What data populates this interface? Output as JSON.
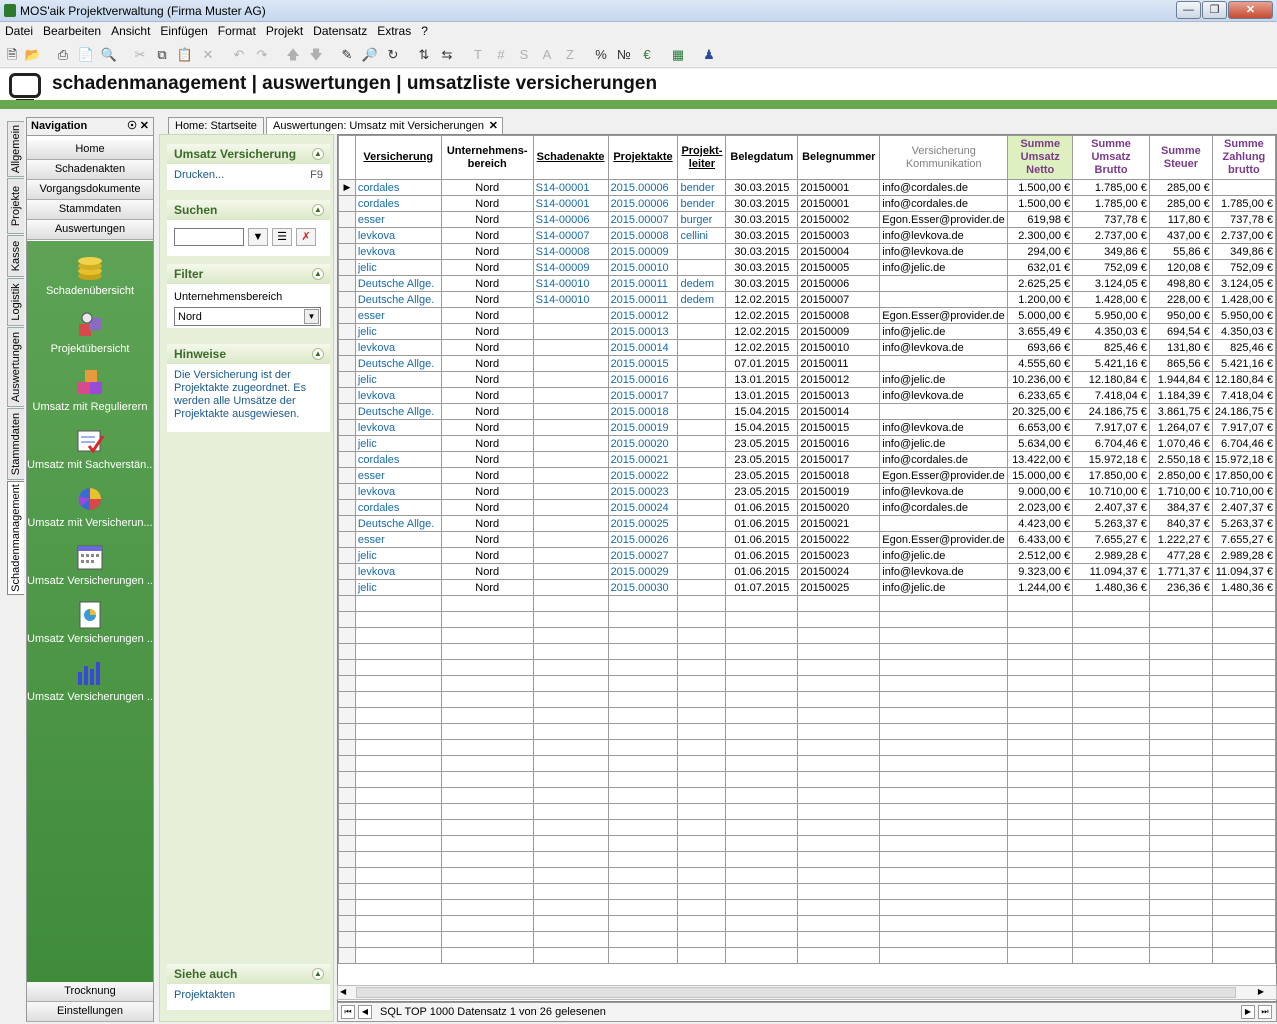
{
  "window": {
    "title": "MOS'aik Projektverwaltung (Firma Muster AG)"
  },
  "menu": [
    "Datei",
    "Bearbeiten",
    "Ansicht",
    "Einfügen",
    "Format",
    "Projekt",
    "Datensatz",
    "Extras",
    "?"
  ],
  "header": {
    "title": "schadenmanagement | auswertungen | umsatzliste versicherungen"
  },
  "vtabs": [
    "Allgemein",
    "Projekte",
    "Kasse",
    "Logistik",
    "Auswertungen",
    "Stammdaten",
    "Schadenmanagement"
  ],
  "nav": {
    "title": "Navigation",
    "pin": "☉",
    "close": "✕",
    "buttons": [
      "Home",
      "Schadenakten",
      "Vorgangsdokumente",
      "Stammdaten",
      "Auswertungen"
    ],
    "items": [
      "Schadenübersicht",
      "Projektübersicht",
      "Umsatz mit Regulierern",
      "Umsatz mit Sachverstän...",
      "Umsatz mit Versicherun...",
      "Umsatz Versicherungen ...",
      "Umsatz Versicherungen ...",
      "Umsatz Versicherungen ..."
    ],
    "bottom": [
      "Trocknung",
      "Einstellungen"
    ]
  },
  "tasks": {
    "g1": {
      "title": "Umsatz Versicherung",
      "item": "Drucken...",
      "key": "F9"
    },
    "g2": {
      "title": "Suchen",
      "search_value": ""
    },
    "g3": {
      "title": "Filter",
      "label": "Unternehmensbereich",
      "value": "Nord"
    },
    "g4": {
      "title": "Hinweise",
      "text": "Die Versicherung ist der Projektakte zugeordnet. Es werden alle Umsätze der Projektakte ausgewiesen."
    },
    "g5": {
      "title": "Siehe auch",
      "item": "Projektakten"
    }
  },
  "doctabs": {
    "home": "Home: Startseite",
    "active": "Auswertungen: Umsatz mit Versicherungen"
  },
  "columns": [
    "Versicherung",
    "Unternehmens-bereich",
    "Schadenakte",
    "Projektakte",
    "Projekt-leiter",
    "Belegdatum",
    "Belegnummer",
    "Versicherung Kommunikation",
    "Summe Umsatz Netto",
    "Summe Umsatz Brutto",
    "Summe Steuer",
    "Summe Zahlung brutto"
  ],
  "rows": [
    [
      "cordales",
      "Nord",
      "S14-00001",
      "2015.00006",
      "bender",
      "30.03.2015",
      "20150001",
      "info@cordales.de",
      "1.500,00 €",
      "1.785,00 €",
      "285,00 €",
      ""
    ],
    [
      "cordales",
      "Nord",
      "S14-00001",
      "2015.00006",
      "bender",
      "30.03.2015",
      "20150001",
      "info@cordales.de",
      "1.500,00 €",
      "1.785,00 €",
      "285,00 €",
      "1.785,00 €"
    ],
    [
      "esser",
      "Nord",
      "S14-00006",
      "2015.00007",
      "burger",
      "30.03.2015",
      "20150002",
      "Egon.Esser@provider.de",
      "619,98 €",
      "737,78 €",
      "117,80 €",
      "737,78 €"
    ],
    [
      "levkova",
      "Nord",
      "S14-00007",
      "2015.00008",
      "cellini",
      "30.03.2015",
      "20150003",
      "info@levkova.de",
      "2.300,00 €",
      "2.737,00 €",
      "437,00 €",
      "2.737,00 €"
    ],
    [
      "levkova",
      "Nord",
      "S14-00008",
      "2015.00009",
      "",
      "30.03.2015",
      "20150004",
      "info@levkova.de",
      "294,00 €",
      "349,86 €",
      "55,86 €",
      "349,86 €"
    ],
    [
      "jelic",
      "Nord",
      "S14-00009",
      "2015.00010",
      "",
      "30.03.2015",
      "20150005",
      "info@jelic.de",
      "632,01 €",
      "752,09 €",
      "120,08 €",
      "752,09 €"
    ],
    [
      "Deutsche Allge.",
      "Nord",
      "S14-00010",
      "2015.00011",
      "dedem",
      "30.03.2015",
      "20150006",
      "",
      "2.625,25 €",
      "3.124,05 €",
      "498,80 €",
      "3.124,05 €"
    ],
    [
      "Deutsche Allge.",
      "Nord",
      "S14-00010",
      "2015.00011",
      "dedem",
      "12.02.2015",
      "20150007",
      "",
      "1.200,00 €",
      "1.428,00 €",
      "228,00 €",
      "1.428,00 €"
    ],
    [
      "esser",
      "Nord",
      "",
      "2015.00012",
      "",
      "12.02.2015",
      "20150008",
      "Egon.Esser@provider.de",
      "5.000,00 €",
      "5.950,00 €",
      "950,00 €",
      "5.950,00 €"
    ],
    [
      "jelic",
      "Nord",
      "",
      "2015.00013",
      "",
      "12.02.2015",
      "20150009",
      "info@jelic.de",
      "3.655,49 €",
      "4.350,03 €",
      "694,54 €",
      "4.350,03 €"
    ],
    [
      "levkova",
      "Nord",
      "",
      "2015.00014",
      "",
      "12.02.2015",
      "20150010",
      "info@levkova.de",
      "693,66 €",
      "825,46 €",
      "131,80 €",
      "825,46 €"
    ],
    [
      "Deutsche Allge.",
      "Nord",
      "",
      "2015.00015",
      "",
      "07.01.2015",
      "20150011",
      "",
      "4.555,60 €",
      "5.421,16 €",
      "865,56 €",
      "5.421,16 €"
    ],
    [
      "jelic",
      "Nord",
      "",
      "2015.00016",
      "",
      "13.01.2015",
      "20150012",
      "info@jelic.de",
      "10.236,00 €",
      "12.180,84 €",
      "1.944,84 €",
      "12.180,84 €"
    ],
    [
      "levkova",
      "Nord",
      "",
      "2015.00017",
      "",
      "13.01.2015",
      "20150013",
      "info@levkova.de",
      "6.233,65 €",
      "7.418,04 €",
      "1.184,39 €",
      "7.418,04 €"
    ],
    [
      "Deutsche Allge.",
      "Nord",
      "",
      "2015.00018",
      "",
      "15.04.2015",
      "20150014",
      "",
      "20.325,00 €",
      "24.186,75 €",
      "3.861,75 €",
      "24.186,75 €"
    ],
    [
      "levkova",
      "Nord",
      "",
      "2015.00019",
      "",
      "15.04.2015",
      "20150015",
      "info@levkova.de",
      "6.653,00 €",
      "7.917,07 €",
      "1.264,07 €",
      "7.917,07 €"
    ],
    [
      "jelic",
      "Nord",
      "",
      "2015.00020",
      "",
      "23.05.2015",
      "20150016",
      "info@jelic.de",
      "5.634,00 €",
      "6.704,46 €",
      "1.070,46 €",
      "6.704,46 €"
    ],
    [
      "cordales",
      "Nord",
      "",
      "2015.00021",
      "",
      "23.05.2015",
      "20150017",
      "info@cordales.de",
      "13.422,00 €",
      "15.972,18 €",
      "2.550,18 €",
      "15.972,18 €"
    ],
    [
      "esser",
      "Nord",
      "",
      "2015.00022",
      "",
      "23.05.2015",
      "20150018",
      "Egon.Esser@provider.de",
      "15.000,00 €",
      "17.850,00 €",
      "2.850,00 €",
      "17.850,00 €"
    ],
    [
      "levkova",
      "Nord",
      "",
      "2015.00023",
      "",
      "23.05.2015",
      "20150019",
      "info@levkova.de",
      "9.000,00 €",
      "10.710,00 €",
      "1.710,00 €",
      "10.710,00 €"
    ],
    [
      "cordales",
      "Nord",
      "",
      "2015.00024",
      "",
      "01.06.2015",
      "20150020",
      "info@cordales.de",
      "2.023,00 €",
      "2.407,37 €",
      "384,37 €",
      "2.407,37 €"
    ],
    [
      "Deutsche Allge.",
      "Nord",
      "",
      "2015.00025",
      "",
      "01.06.2015",
      "20150021",
      "",
      "4.423,00 €",
      "5.263,37 €",
      "840,37 €",
      "5.263,37 €"
    ],
    [
      "esser",
      "Nord",
      "",
      "2015.00026",
      "",
      "01.06.2015",
      "20150022",
      "Egon.Esser@provider.de",
      "6.433,00 €",
      "7.655,27 €",
      "1.222,27 €",
      "7.655,27 €"
    ],
    [
      "jelic",
      "Nord",
      "",
      "2015.00027",
      "",
      "01.06.2015",
      "20150023",
      "info@jelic.de",
      "2.512,00 €",
      "2.989,28 €",
      "477,28 €",
      "2.989,28 €"
    ],
    [
      "levkova",
      "Nord",
      "",
      "2015.00029",
      "",
      "01.06.2015",
      "20150024",
      "info@levkova.de",
      "9.323,00 €",
      "11.094,37 €",
      "1.771,37 €",
      "11.094,37 €"
    ],
    [
      "jelic",
      "Nord",
      "",
      "2015.00030",
      "",
      "01.07.2015",
      "20150025",
      "info@jelic.de",
      "1.244,00 €",
      "1.480,36 €",
      "236,36 €",
      "1.480,36 €"
    ]
  ],
  "status": {
    "text": "SQL TOP 1000 Datensatz 1 von 26 gelesenen"
  },
  "colors": {
    "accent_green": "#6aa84f",
    "nav_green": "#4a9a45",
    "link_blue": "#1a6aaa",
    "sum_header": "#7a3b8a"
  }
}
